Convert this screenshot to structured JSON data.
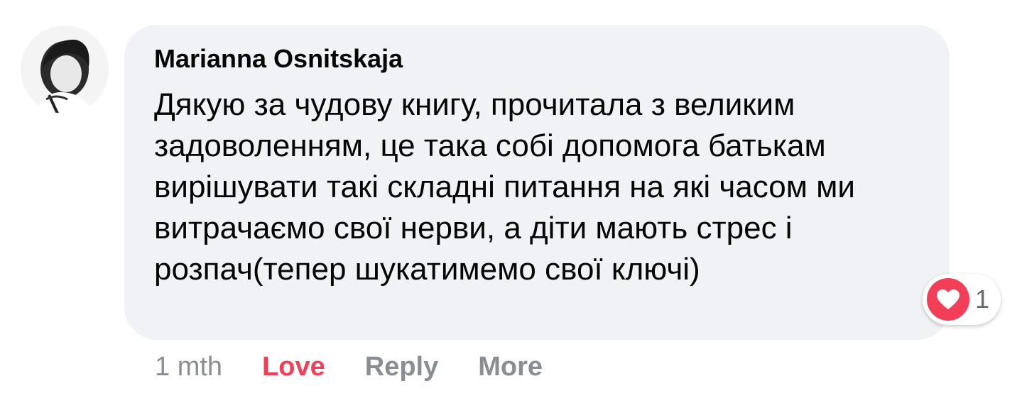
{
  "comment": {
    "author": "Marianna Osnitskaja",
    "text": "Дякую за чудову книгу, прочитала з великим задоволенням, це така собі допомога батькам вирішувати такі складні питання на які часом ми витрачаємо свої нерви, а діти мають стрес і розпач(тепер шукатимемо свої ключі)",
    "reaction": {
      "icon": "heart-icon",
      "count": "1",
      "color": "#f33e58"
    }
  },
  "actions": {
    "timestamp": "1 mth",
    "love_label": "Love",
    "reply_label": "Reply",
    "more_label": "More"
  },
  "colors": {
    "bubble": "#f0f2f5",
    "love": "#f33e58",
    "secondary": "#8a8d91"
  }
}
